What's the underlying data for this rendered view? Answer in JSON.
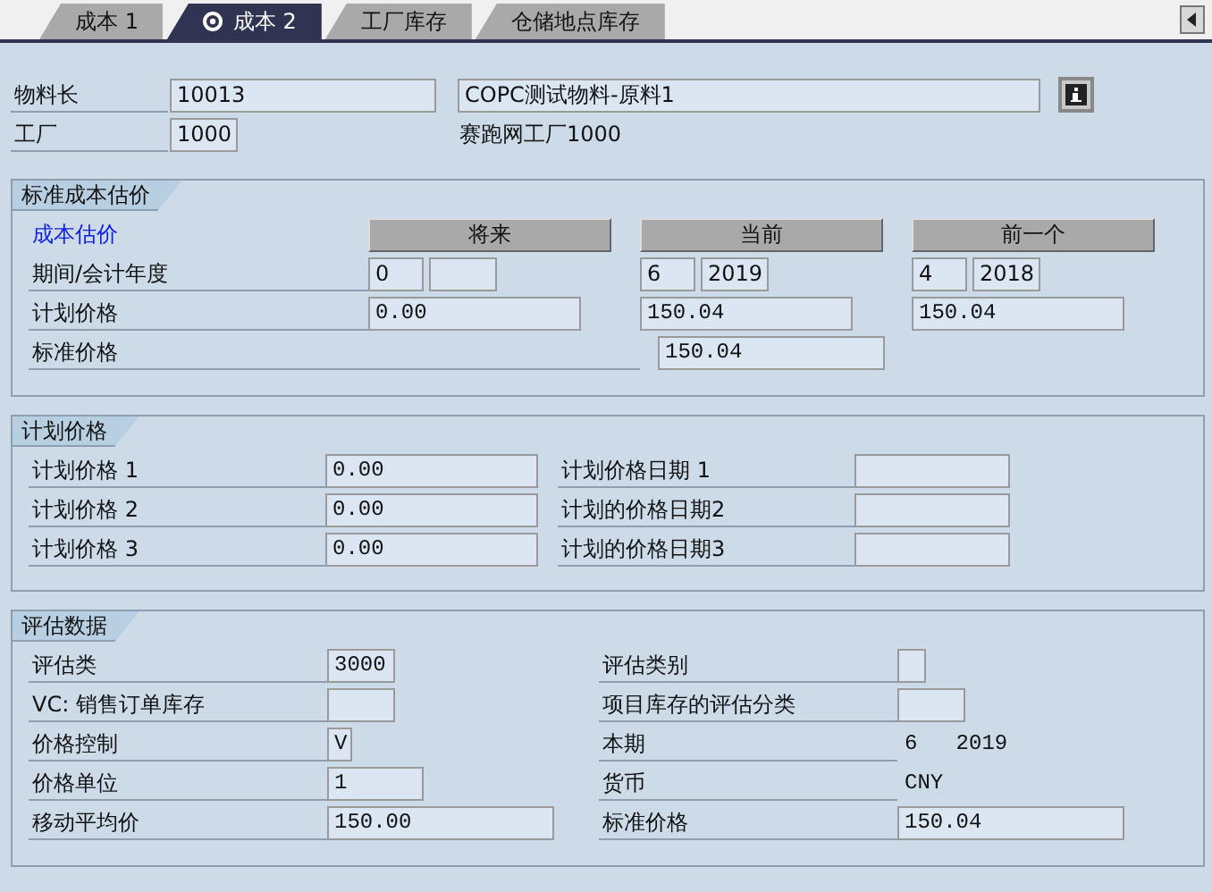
{
  "tabs": [
    {
      "label": "成本 1",
      "selected": false
    },
    {
      "label": "成本 2",
      "selected": true
    },
    {
      "label": "工厂库存",
      "selected": false
    },
    {
      "label": "仓储地点库存",
      "selected": false
    }
  ],
  "header": {
    "material_label": "物料长",
    "material": "10013",
    "description": "COPC测试物料-原料1",
    "plant_label": "工厂",
    "plant": "1000",
    "plant_name": "赛跑网工厂1000"
  },
  "standard_cost": {
    "title": "标准成本估价",
    "heading": "成本估价",
    "period_label": "期间/会计年度",
    "planned_label": "计划价格",
    "standard_label": "标准价格",
    "columns": [
      {
        "button": "将来",
        "period": "0",
        "planned": "0.00"
      },
      {
        "button": "当前",
        "period": "6",
        "year": "2019",
        "planned": "150.04",
        "standard": "150.04"
      },
      {
        "button": "前一个",
        "period": "4",
        "year": "2018",
        "planned": "150.04"
      }
    ]
  },
  "planned_prices": {
    "title": "计划价格",
    "rows": [
      {
        "label": "计划价格 1",
        "value": "0.00",
        "date_label": "计划价格日期 1"
      },
      {
        "label": "计划价格 2",
        "value": "0.00",
        "date_label": "计划的价格日期2"
      },
      {
        "label": "计划价格 3",
        "value": "0.00",
        "date_label": "计划的价格日期3"
      }
    ]
  },
  "valuation": {
    "title": "评估数据",
    "rows": [
      {
        "label": "评估类",
        "value": "3000",
        "right": {
          "label": "评估类别",
          "kind": "field"
        }
      },
      {
        "label": "VC: 销售订单库存",
        "right": {
          "label": "项目库存的评估分类",
          "kind": "field"
        }
      },
      {
        "label": "价格控制",
        "value": "V",
        "right": {
          "label": "本期",
          "kind": "text",
          "value": "6   2019"
        }
      },
      {
        "label": "价格单位",
        "value": "1",
        "right": {
          "label": "货币",
          "kind": "text",
          "value": "CNY"
        }
      },
      {
        "label": "移动平均价",
        "value": "150.00",
        "right": {
          "label": "标准价格",
          "kind": "field",
          "value": "150.04"
        }
      }
    ]
  }
}
